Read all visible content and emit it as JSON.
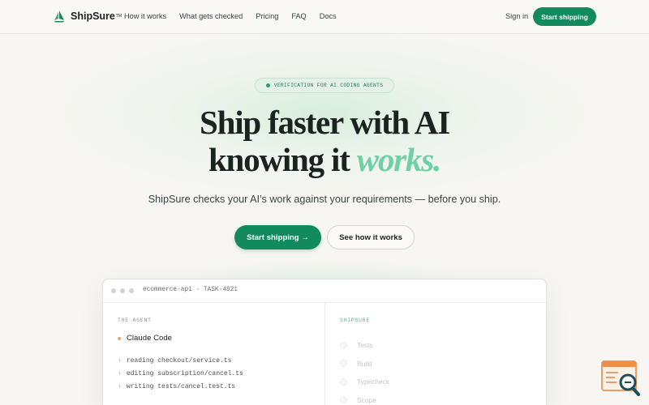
{
  "nav": {
    "brand": "ShipSure",
    "trademark": "TM",
    "links": [
      "How it works",
      "What gets checked",
      "Pricing",
      "FAQ",
      "Docs"
    ],
    "signin": "Sign in",
    "cta": "Start shipping"
  },
  "hero": {
    "badge": "VERIFICATION FOR AI CODING AGENTS",
    "headline_line1": "Ship faster with AI",
    "headline_line2_prefix": "knowing it ",
    "headline_line2_accent": "works.",
    "subhead": "ShipSure checks your AI’s work against your requirements — before you ship.",
    "primary_cta": "Start shipping →",
    "secondary_cta": "See how it works"
  },
  "demo": {
    "window_title": "ecommerce-api · TASK-4821",
    "agent_section_label": "THE AGENT",
    "agent_name": "Claude Code",
    "log_lines": [
      "reading checkout/service.ts",
      "editing subscription/cancel.ts",
      "writing tests/cancel.test.ts"
    ],
    "shipsure_section_label": "SHIPSURE",
    "checks": [
      "Tests",
      "Build",
      "Typecheck",
      "Scope"
    ]
  },
  "colors": {
    "brand_green": "#138a5e",
    "accent_mint": "#6fd0a5",
    "background": "#f7f6f2"
  },
  "icons": {
    "brand_logo": "sail-icon",
    "widget": "search-magnifier-icon"
  }
}
